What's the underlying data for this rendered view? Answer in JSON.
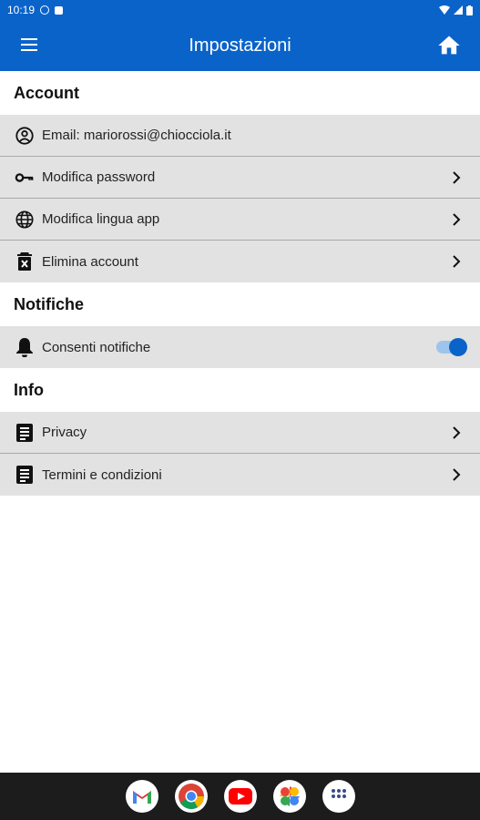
{
  "status_bar": {
    "time": "10:19"
  },
  "app_bar": {
    "title": "Impostazioni"
  },
  "sections": {
    "account": {
      "title": "Account",
      "email": "Email: mariorossi@chiocciola.it",
      "password": "Modifica password",
      "language": "Modifica lingua app",
      "delete": "Elimina account"
    },
    "notifications": {
      "title": "Notifiche",
      "allow": "Consenti notifiche",
      "allow_enabled": true
    },
    "info": {
      "title": "Info",
      "privacy": "Privacy",
      "terms": "Termini e condizioni"
    }
  },
  "colors": {
    "primary": "#0a63c9",
    "row_bg": "#e2e2e2",
    "divider": "#a9a9a9"
  },
  "dock": [
    "gmail-icon",
    "chrome-icon",
    "youtube-icon",
    "photos-icon",
    "app-drawer-icon"
  ]
}
